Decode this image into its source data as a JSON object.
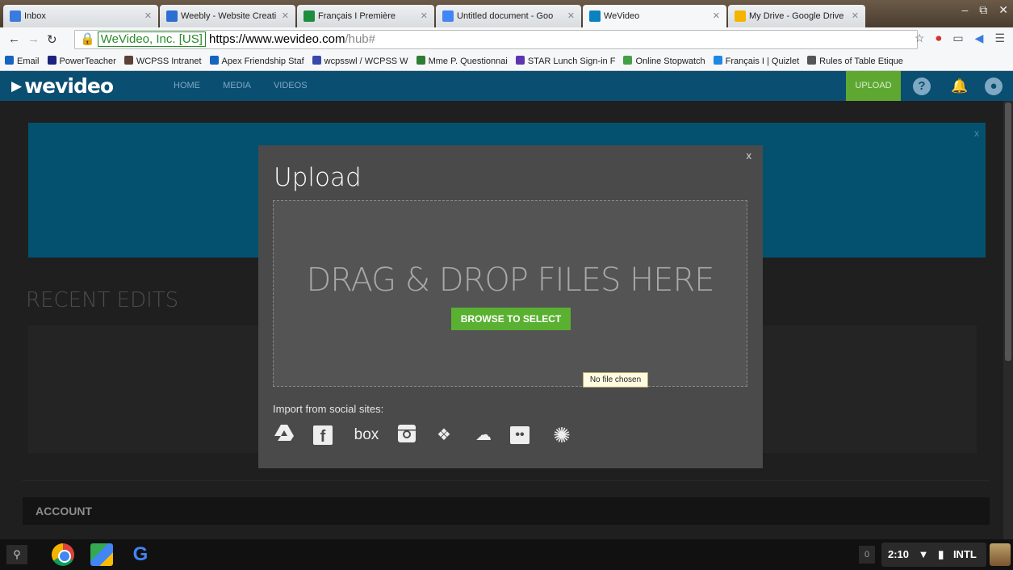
{
  "browser": {
    "tabs": [
      {
        "label": "Inbox",
        "color": "#3b7be0"
      },
      {
        "label": "Weebly - Website Creati",
        "color": "#2c6fd1"
      },
      {
        "label": "Français I Première",
        "color": "#1e8e3e"
      },
      {
        "label": "Untitled document - Goo",
        "color": "#4285f4"
      },
      {
        "label": "WeVideo",
        "color": "#0a82c0"
      },
      {
        "label": "My Drive - Google Drive",
        "color": "#f4b400"
      }
    ],
    "address": {
      "org": "WeVideo, Inc. [US]",
      "url_main": "https://www.wevideo.com",
      "url_path": "/hub#"
    },
    "bookmarks": [
      {
        "label": "Email",
        "color": "#1565c0"
      },
      {
        "label": "PowerTeacher",
        "color": "#1a237e"
      },
      {
        "label": "WCPSS Intranet",
        "color": "#5d4037"
      },
      {
        "label": "Apex Friendship Staf",
        "color": "#1565c0"
      },
      {
        "label": "wcpsswl / WCPSS W",
        "color": "#3949ab"
      },
      {
        "label": "Mme P. Questionnai",
        "color": "#2e7d32"
      },
      {
        "label": "STAR Lunch Sign-in F",
        "color": "#5e35b1"
      },
      {
        "label": "Online Stopwatch",
        "color": "#43a047"
      },
      {
        "label": "Français I | Quizlet",
        "color": "#1e88e5"
      },
      {
        "label": "Rules of Table Etique",
        "color": "#555555"
      }
    ]
  },
  "app": {
    "logo": "wevideo",
    "nav": [
      "HOME",
      "MEDIA",
      "VIDEOS"
    ],
    "upload_label": "UPLOAD",
    "help_symbol": "?",
    "banner_close": "x",
    "recent_edits": "RECENT EDITS",
    "account": "ACCOUNT"
  },
  "modal": {
    "title": "Upload",
    "close": "x",
    "drop_text": "DRAG & DROP FILES HERE",
    "browse_label": "BROWSE TO SELECT",
    "tooltip": "No file chosen",
    "import_label": "Import from social sites:",
    "social": [
      {
        "name": "google-drive",
        "glyph": "▲"
      },
      {
        "name": "facebook",
        "glyph": "f"
      },
      {
        "name": "box",
        "glyph": "box"
      },
      {
        "name": "instagram",
        "glyph": "◘"
      },
      {
        "name": "dropbox",
        "glyph": "❖"
      },
      {
        "name": "onedrive",
        "glyph": "☁"
      },
      {
        "name": "flickr",
        "glyph": "••"
      },
      {
        "name": "picasa",
        "glyph": "✺"
      }
    ]
  },
  "taskbar": {
    "search_symbol": "🔍",
    "notif_count": "0",
    "time": "2:10",
    "input": "INTL"
  },
  "colors": {
    "accent_green": "#5ab031",
    "header_blue": "#0a4e72",
    "banner_blue": "#04506f"
  }
}
